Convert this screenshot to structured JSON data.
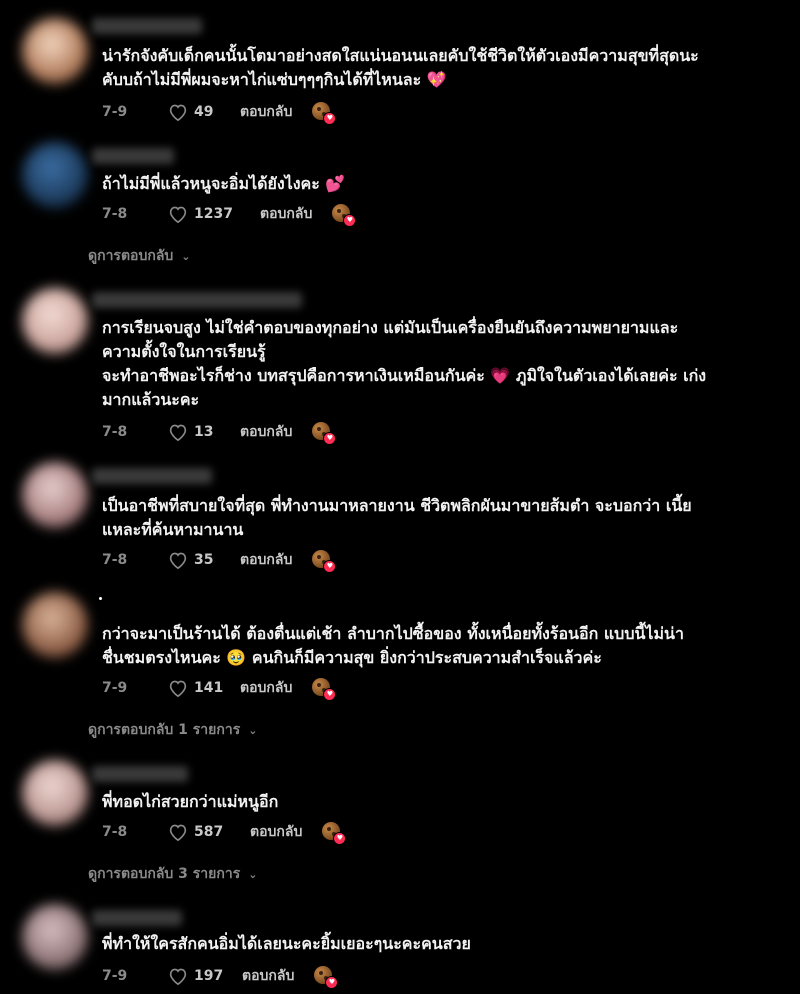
{
  "comments": [
    {
      "text": "น่ารักจังคับเด็กคนนั้นโตมาอย่างสดใสแน่นอนนเลยคับใช้ชีวิตให้ตัวเองมีความสุขที่สุดนะ\nคับบถ้าไม่มีพี่ผมจะหาไก่แซ่บๆๆๆกินได้ที่ไหนละ 💖",
      "date": "7-9",
      "likes": "49",
      "reply_label": "ตอบกลับ"
    },
    {
      "text": "ถ้าไม่มีพี่แล้วหนูจะอิ่มได้ยังไงคะ 💕",
      "date": "7-8",
      "likes": "1237",
      "reply_label": "ตอบกลับ",
      "view_replies": "ดูการตอบกลับ"
    },
    {
      "text": "การเรียนจบสูง ไม่ใช่คำตอบของทุกอย่าง แต่มันเป็นเครื่องยืนยันถึงความพยายามและ\nความตั้งใจในการเรียนรู้\nจะทำอาชีพอะไรก็ช่าง บทสรุปคือการหาเงินเหมือนกันค่ะ 💗 ภูมิใจในตัวเองได้เลยค่ะ เก่ง\nมากแล้วนะคะ",
      "date": "7-8",
      "likes": "13",
      "reply_label": "ตอบกลับ"
    },
    {
      "text": "เป็นอาชีพที่สบายใจที่สุด พี่ทำงานมาหลายงาน ชีวิตพลิกผันมาขายส้มตำ จะบอกว่า เนี้ย\nแหละที่ค้นหามานาน",
      "date": "7-8",
      "likes": "35",
      "reply_label": "ตอบกลับ"
    },
    {
      "text": "กว่าจะมาเป็นร้านได้ ต้องตื่นแต่เช้า ลำบากไปซื้อของ ทั้งเหนื่อยทั้งร้อนอีก แบบนี้ไม่น่า\nชื่นชมตรงไหนคะ 🥹 คนกินก็มีความสุข ยิ่งกว่าประสบความสำเร็จแล้วค่ะ",
      "date": "7-9",
      "likes": "141",
      "reply_label": "ตอบกลับ",
      "view_replies": "ดูการตอบกลับ 1 รายการ"
    },
    {
      "text": "พี่ทอดไก่สวยกว่าแม่หนูอีก",
      "date": "7-8",
      "likes": "587",
      "reply_label": "ตอบกลับ",
      "view_replies": "ดูการตอบกลับ 3 รายการ"
    },
    {
      "text": "พี่ทำให้ใครสักคนอิ่มได้เลยนะคะยิ้มเยอะๆนะคะคนสวย",
      "date": "7-9",
      "likes": "197",
      "reply_label": "ตอบกลับ"
    }
  ],
  "colors": {
    "background": "#000000",
    "text": "#f2f2f2",
    "muted": "#8a8a8a",
    "badge": "#fe2c55"
  }
}
